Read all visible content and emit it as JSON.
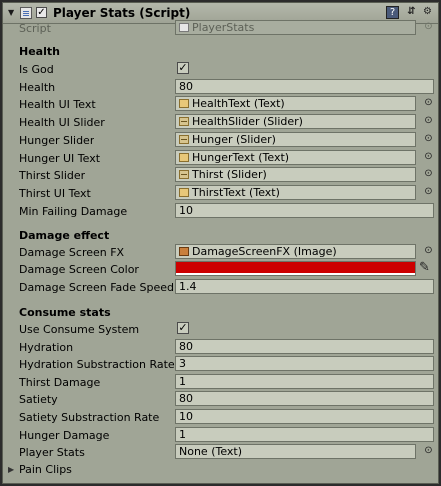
{
  "header": {
    "title": "Player Stats (Script)",
    "enabled": true,
    "icons": [
      "script-icon",
      "book-icon",
      "preset-icon",
      "gear-icon"
    ]
  },
  "script_row": {
    "label": "Script",
    "value": "PlayerStats"
  },
  "health": {
    "heading": "Health",
    "is_god_label": "Is God",
    "is_god": true,
    "health_label": "Health",
    "health_value": "80",
    "health_ui_text_label": "Health UI Text",
    "health_ui_text_value": "HealthText (Text)",
    "health_ui_slider_label": "Health UI Slider",
    "health_ui_slider_value": "HealthSlider (Slider)",
    "hunger_slider_label": "Hunger Slider",
    "hunger_slider_value": "Hunger (Slider)",
    "hunger_ui_text_label": "Hunger UI Text",
    "hunger_ui_text_value": "HungerText (Text)",
    "thirst_slider_label": "Thirst Slider",
    "thirst_slider_value": "Thirst (Slider)",
    "thirst_ui_text_label": "Thirst UI Text",
    "thirst_ui_text_value": "ThirstText (Text)",
    "min_failing_label": "Min Failing Damage",
    "min_failing_value": "10"
  },
  "damage": {
    "heading": "Damage effect",
    "screen_fx_label": "Damage Screen FX",
    "screen_fx_value": "DamageScreenFX (Image)",
    "screen_color_label": "Damage Screen Color",
    "screen_color": "#cd0000",
    "fade_speed_label": "Damage Screen Fade Speed",
    "fade_speed_value": "1.4"
  },
  "consume": {
    "heading": "Consume stats",
    "use_system_label": "Use Consume System",
    "use_system": true,
    "hydration_label": "Hydration",
    "hydration_value": "80",
    "hydration_rate_label": "Hydration Substraction Rate",
    "hydration_rate_value": "3",
    "thirst_damage_label": "Thirst Damage",
    "thirst_damage_value": "1",
    "satiety_label": "Satiety",
    "satiety_value": "80",
    "satiety_rate_label": "Satiety Substraction Rate",
    "satiety_rate_value": "10",
    "hunger_damage_label": "Hunger Damage",
    "hunger_damage_value": "1",
    "player_stats_label": "Player Stats",
    "player_stats_value": "None (Text)"
  },
  "pain_clips": {
    "label": "Pain Clips"
  },
  "glyphs": {
    "check": "✓",
    "foldout_open": "▼",
    "foldout_closed": "▶",
    "picker": "⊙",
    "gear": "⚙",
    "book": "?",
    "preset": "⇵",
    "dropper": "✎"
  }
}
